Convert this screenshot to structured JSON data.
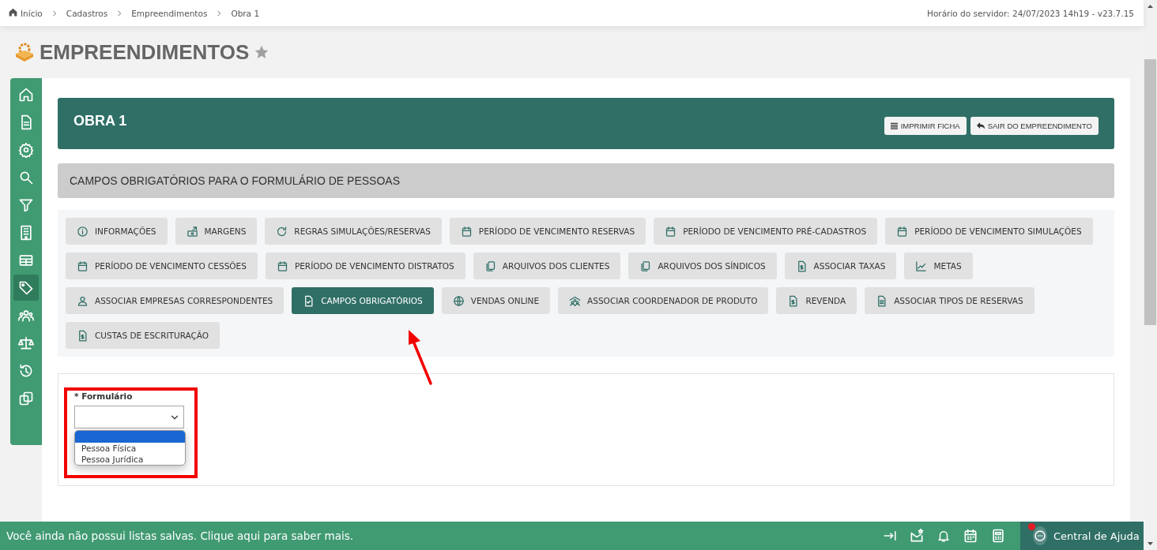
{
  "breadcrumb": [
    {
      "label": "Início"
    },
    {
      "label": "Cadastros"
    },
    {
      "label": "Empreendimentos"
    },
    {
      "label": "Obra 1"
    }
  ],
  "server_time": "Horário do servidor: 24/07/2023 14h19 - v23.7.15",
  "page_title": {
    "text": "EMPREENDIMENTOS",
    "favorite": false
  },
  "sidebar": {
    "items": [
      {
        "selected": false
      },
      {
        "selected": false
      },
      {
        "selected": false
      },
      {
        "selected": false
      },
      {
        "selected": false
      },
      {
        "selected": false
      },
      {
        "selected": false
      },
      {
        "selected": true
      },
      {
        "selected": false
      },
      {
        "selected": false
      },
      {
        "selected": false
      },
      {
        "selected": false
      }
    ]
  },
  "header": {
    "title": "OBRA 1",
    "buttons": [
      "IMPRIMIR FICHA",
      "SAIR DO EMPREENDIMENTO"
    ]
  },
  "section_title": "CAMPOS OBRIGATÓRIOS PARA O FORMULÁRIO DE PESSOAS",
  "tab_rows": [
    [
      {
        "label": "INFORMAÇÕES",
        "selected": false
      },
      {
        "label": "MARGENS",
        "selected": false
      },
      {
        "label": "REGRAS SIMULAÇÕES/RESERVAS",
        "selected": false
      },
      {
        "label": "PERÍODO DE VENCIMENTO RESERVAS",
        "selected": false
      },
      {
        "label": "PERÍODO DE VENCIMENTO PRÉ-CADASTROS",
        "selected": false
      },
      {
        "label": "PERÍODO DE VENCIMENTO SIMULAÇÕES",
        "selected": false
      }
    ],
    [
      {
        "label": "PERÍODO DE VENCIMENTO CESSÕES",
        "selected": false
      },
      {
        "label": "PERÍODO DE VENCIMENTO DISTRATOS",
        "selected": false
      },
      {
        "label": "ARQUIVOS DOS CLIENTES",
        "selected": false
      },
      {
        "label": "ARQUIVOS DOS SÍNDICOS",
        "selected": false
      },
      {
        "label": "ASSOCIAR TAXAS",
        "selected": false
      },
      {
        "label": "METAS",
        "selected": false
      }
    ],
    [
      {
        "label": "ASSOCIAR EMPRESAS CORRESPONDENTES",
        "selected": false
      },
      {
        "label": "CAMPOS OBRIGATÓRIOS",
        "selected": true
      },
      {
        "label": "VENDAS ONLINE",
        "selected": false
      },
      {
        "label": "ASSOCIAR COORDENADOR DE PRODUTO",
        "selected": false
      },
      {
        "label": "REVENDA",
        "selected": false
      },
      {
        "label": "ASSOCIAR TIPOS DE RESERVAS",
        "selected": false
      }
    ],
    [
      {
        "label": "CUSTAS DE ESCRITURAÇÃO",
        "selected": false
      }
    ]
  ],
  "form": {
    "label": "* Formulário",
    "dropdown": {
      "open": true,
      "options": [
        {
          "selected": true
        },
        {
          "label": "Pessoa Física",
          "selected": false
        },
        {
          "label": "Pessoa Jurídica",
          "selected": false
        }
      ]
    }
  },
  "annotation": {
    "highlight_box": true,
    "arrow": true
  },
  "status_bar": {
    "message": "Você ainda não possui listas salvas. Clique aqui para saber mais.",
    "help": {
      "label": "Central de Ajuda",
      "notification": true
    }
  }
}
